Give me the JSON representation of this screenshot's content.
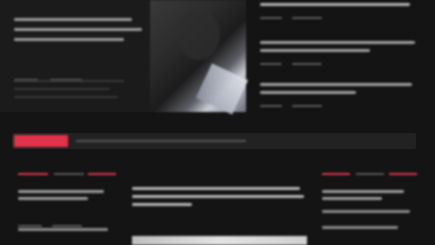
{
  "hero": {
    "title": "",
    "author": "",
    "date": ""
  },
  "breaking": {
    "label": "",
    "text": ""
  },
  "right_list": [
    {
      "title": "",
      "meta": ""
    },
    {
      "title": "",
      "meta": ""
    },
    {
      "title": "",
      "meta": ""
    }
  ],
  "sections": [
    {
      "label": ""
    },
    {
      "label": ""
    },
    {
      "label": ""
    }
  ],
  "feature": {
    "title": ""
  },
  "colors": {
    "accent": "#e0334b",
    "bg": "#141414"
  }
}
